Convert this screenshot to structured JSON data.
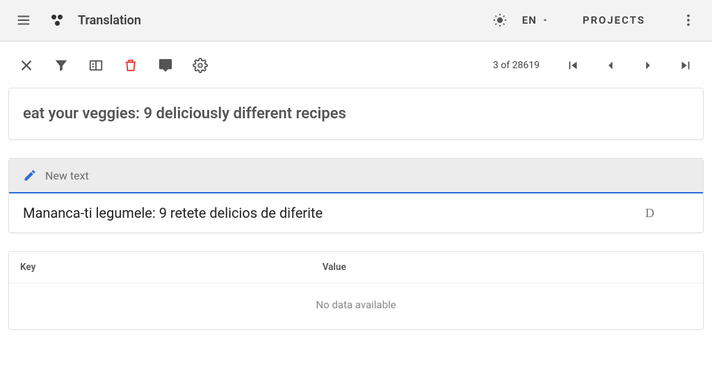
{
  "header": {
    "title": "Translation",
    "language": "EN",
    "projects": "PROJECTS"
  },
  "toolbar": {
    "counter": "3 of 28619"
  },
  "source": {
    "text": "eat your veggies: 9 deliciously different recipes"
  },
  "target": {
    "label": "New text",
    "text": "Mananca-ti legumele: 9 retete delicios de diferite",
    "badge": "D"
  },
  "table": {
    "col_key": "Key",
    "col_value": "Value",
    "empty": "No data available"
  }
}
